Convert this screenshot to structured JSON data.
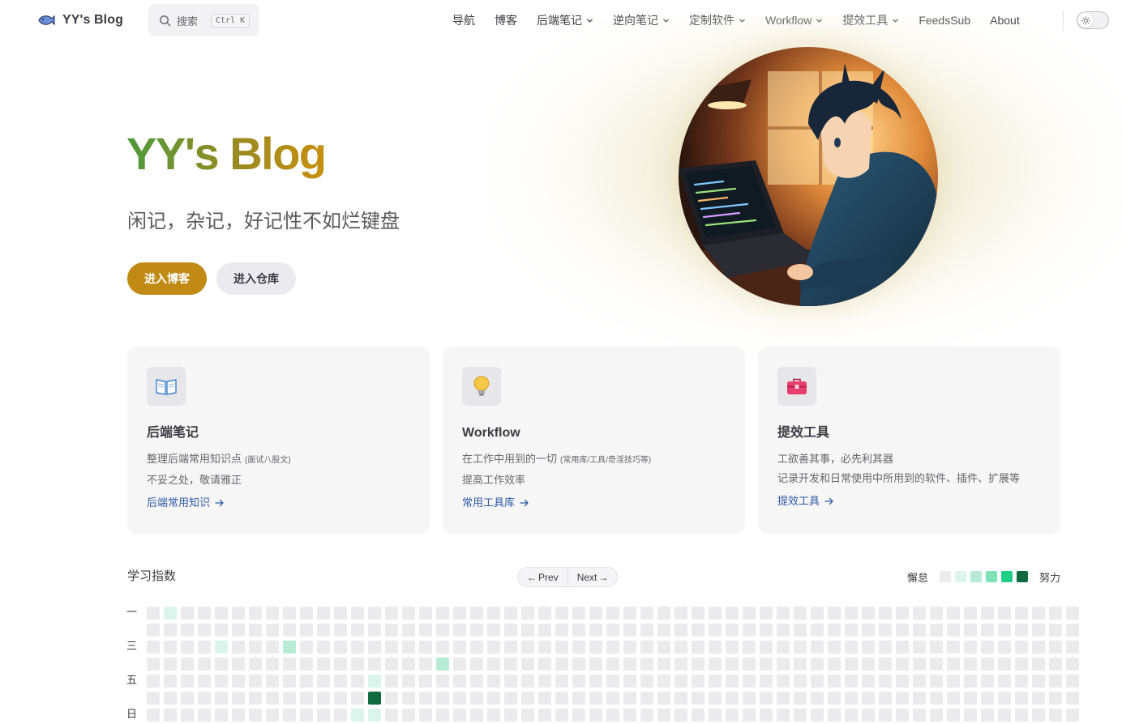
{
  "nav": {
    "brand_title": "YY's Blog",
    "brand_icon": "fish-logo-icon",
    "search_label": "搜索",
    "search_kbd": "Ctrl K",
    "menu": [
      {
        "label": "导航",
        "dropdown": false
      },
      {
        "label": "博客",
        "dropdown": false
      },
      {
        "label": "后端笔记",
        "dropdown": true
      },
      {
        "label": "逆向笔记",
        "dropdown": true
      },
      {
        "label": "定制软件",
        "dropdown": true
      },
      {
        "label": "Workflow",
        "dropdown": true
      },
      {
        "label": "提效工具",
        "dropdown": true
      },
      {
        "label": "FeedsSub",
        "dropdown": false
      },
      {
        "label": "About",
        "dropdown": false
      }
    ],
    "theme_toggle_icon": "sun-icon"
  },
  "hero": {
    "title": "YY's Blog",
    "tagline": "闲记，杂记，好记性不如烂键盘",
    "primary_button": "进入博客",
    "secondary_button": "进入仓库",
    "image_subject": "anime boy coding at laptop",
    "colors": {
      "primary": "#c08a14",
      "title_from": "#4e9a3c",
      "title_to": "#c8900e"
    }
  },
  "features": [
    {
      "icon": "book-icon",
      "title": "后端笔记",
      "line1": "整理后端常用知识点",
      "line1_note": "(面试八股文)",
      "line2": "不妥之处，敬请雅正",
      "link": "后端常用知识"
    },
    {
      "icon": "lightbulb-icon",
      "title": "Workflow",
      "line1": "在工作中用到的一切",
      "line1_note": "(常用库/工具/奇淫技巧等)",
      "line2": "提高工作效率",
      "link": "常用工具库"
    },
    {
      "icon": "toolbox-icon",
      "title": "提效工具",
      "line1": "工欲善其事，必先利其器",
      "line1_note": "",
      "line2": "记录开发和日常使用中所用到的软件、插件、扩展等",
      "link": "提效工具"
    }
  ],
  "heatmap": {
    "title": "学习指数",
    "prev": "Prev",
    "next": "Next",
    "legend_low": "懈怠",
    "legend_high": "努力",
    "legend_colors": [
      "#ebebed",
      "#dcf5ec",
      "#b8ebd5",
      "#7ee2b8",
      "#1fcf86",
      "#0f6b3f"
    ],
    "day_labels": [
      "一",
      "",
      "三",
      "",
      "五",
      "",
      "日"
    ],
    "weeks": 55,
    "active_cells": [
      {
        "week": 1,
        "day": 0,
        "level": 1
      },
      {
        "week": 4,
        "day": 2,
        "level": 1
      },
      {
        "week": 8,
        "day": 2,
        "level": 2
      },
      {
        "week": 13,
        "day": 4,
        "level": 1
      },
      {
        "week": 13,
        "day": 5,
        "level": 5
      },
      {
        "week": 12,
        "day": 6,
        "level": 1
      },
      {
        "week": 13,
        "day": 6,
        "level": 1
      },
      {
        "week": 17,
        "day": 3,
        "level": 2
      }
    ]
  }
}
